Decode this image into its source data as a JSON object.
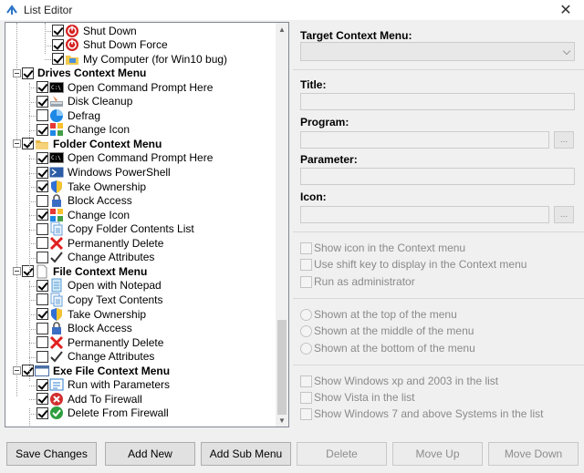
{
  "window": {
    "title": "List Editor",
    "close_glyph": "✕"
  },
  "tree": {
    "rows": [
      {
        "label": "Shut Down",
        "checked": true,
        "icon": "shutdown-icon",
        "bold": false
      },
      {
        "label": "Shut Down Force",
        "checked": true,
        "icon": "shutdown-force-icon",
        "bold": false
      },
      {
        "label": "My Computer (for Win10 bug)",
        "checked": true,
        "icon": "computer-folder-icon",
        "bold": false
      },
      {
        "label": "Drives Context Menu",
        "checked": true,
        "icon": "",
        "bold": true
      },
      {
        "label": "Open Command Prompt Here",
        "checked": true,
        "icon": "cmd-icon",
        "bold": false
      },
      {
        "label": "Disk Cleanup",
        "checked": true,
        "icon": "disk-cleanup-icon",
        "bold": false
      },
      {
        "label": "Defrag",
        "checked": false,
        "icon": "defrag-icon",
        "bold": false
      },
      {
        "label": "Change Icon",
        "checked": true,
        "icon": "change-icon-icon",
        "bold": false
      },
      {
        "label": "Folder Context Menu",
        "checked": true,
        "icon": "folder-icon",
        "bold": true
      },
      {
        "label": "Open Command Prompt Here",
        "checked": true,
        "icon": "cmd-icon",
        "bold": false
      },
      {
        "label": "Windows PowerShell",
        "checked": true,
        "icon": "powershell-icon",
        "bold": false
      },
      {
        "label": "Take Ownership",
        "checked": true,
        "icon": "shield-icon",
        "bold": false
      },
      {
        "label": "Block Access",
        "checked": false,
        "icon": "lock-icon",
        "bold": false
      },
      {
        "label": "Change Icon",
        "checked": true,
        "icon": "change-icon-icon",
        "bold": false
      },
      {
        "label": "Copy Folder Contents List",
        "checked": false,
        "icon": "copy-list-icon",
        "bold": false
      },
      {
        "label": "Permanently Delete",
        "checked": false,
        "icon": "delete-x-icon",
        "bold": false
      },
      {
        "label": "Change Attributes",
        "checked": false,
        "icon": "attributes-check-icon",
        "bold": false
      },
      {
        "label": "File Context Menu",
        "checked": true,
        "icon": "file-icon",
        "bold": true
      },
      {
        "label": "Open with Notepad",
        "checked": true,
        "icon": "notepad-icon",
        "bold": false
      },
      {
        "label": "Copy Text Contents",
        "checked": false,
        "icon": "copy-list-icon",
        "bold": false
      },
      {
        "label": "Take Ownership",
        "checked": true,
        "icon": "shield-icon",
        "bold": false
      },
      {
        "label": "Block Access",
        "checked": false,
        "icon": "lock-icon",
        "bold": false
      },
      {
        "label": "Permanently Delete",
        "checked": false,
        "icon": "delete-x-icon",
        "bold": false
      },
      {
        "label": "Change Attributes",
        "checked": false,
        "icon": "attributes-check-icon",
        "bold": false
      },
      {
        "label": "Exe File Context Menu",
        "checked": true,
        "icon": "exe-window-icon",
        "bold": true
      },
      {
        "label": "Run with Parameters",
        "checked": true,
        "icon": "run-params-icon",
        "bold": false
      },
      {
        "label": "Add To Firewall",
        "checked": true,
        "icon": "firewall-add-icon",
        "bold": false
      },
      {
        "label": "Delete From Firewall",
        "checked": true,
        "icon": "firewall-delete-icon",
        "bold": false
      }
    ]
  },
  "form": {
    "target_label": "Target Context Menu:",
    "title_label": "Title:",
    "program_label": "Program:",
    "parameter_label": "Parameter:",
    "icon_label": "Icon:",
    "browse_glyph": "...",
    "options": [
      "Show icon in the Context menu",
      "Use shift key to display in the Context menu",
      "Run as administrator"
    ],
    "positions": [
      "Shown at the top of the menu",
      "Shown at the middle of the menu",
      "Shown at the bottom of the menu"
    ],
    "systems": [
      "Show Windows xp  and 2003 in the list",
      "Show Vista in the list",
      "Show Windows 7 and above Systems in the list"
    ]
  },
  "buttons": {
    "save": "Save Changes",
    "add_new": "Add New",
    "add_sub": "Add Sub Menu",
    "delete": "Delete",
    "move_up": "Move Up",
    "move_down": "Move Down"
  },
  "colors": {
    "accent": "#0078d7",
    "disabled_text": "#8d8d8d"
  }
}
